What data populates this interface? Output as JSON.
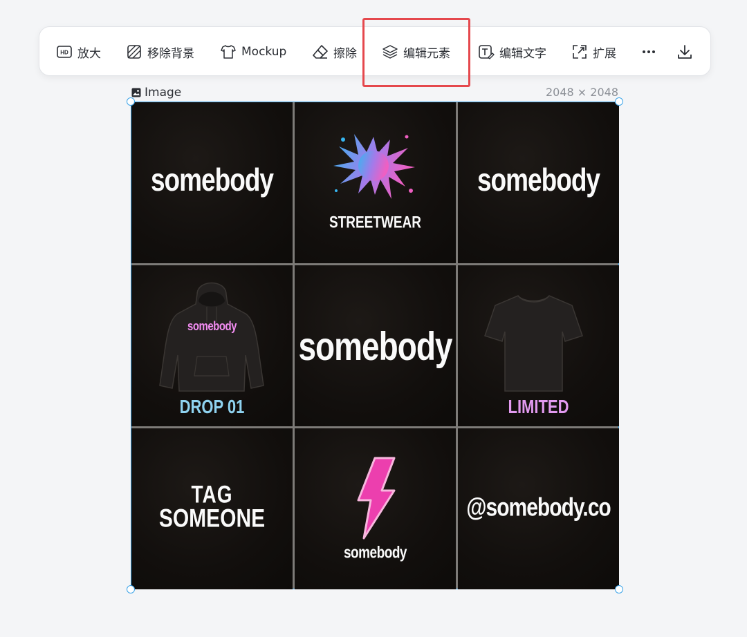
{
  "toolbar": {
    "upscale_label": "放大",
    "remove_bg_label": "移除背景",
    "mockup_label": "Mockup",
    "erase_label": "擦除",
    "edit_elements_label": "编辑元素",
    "edit_text_label": "编辑文字",
    "expand_label": "扩展",
    "hd_badge": "HD"
  },
  "image": {
    "label": "Image",
    "dimensions": "2048 × 2048"
  },
  "tiles": {
    "t1": "somebody",
    "t2": "STREETWEAR",
    "t3": "somebody",
    "t4_logo": "somebody",
    "t4_caption": "DROP 01",
    "t5": "somebody",
    "t6_caption": "LIMITED",
    "t7_line1": "TAG",
    "t7_line2": "SOMEONE",
    "t8": "somebody",
    "t9": "@somebody.co"
  },
  "colors": {
    "accent_blue": "#3ba3e8",
    "highlight_red": "#e5484d",
    "cyan_caption": "#8fd3f0",
    "pink_caption": "#e29af0",
    "bolt_pink": "#ec3fae"
  }
}
